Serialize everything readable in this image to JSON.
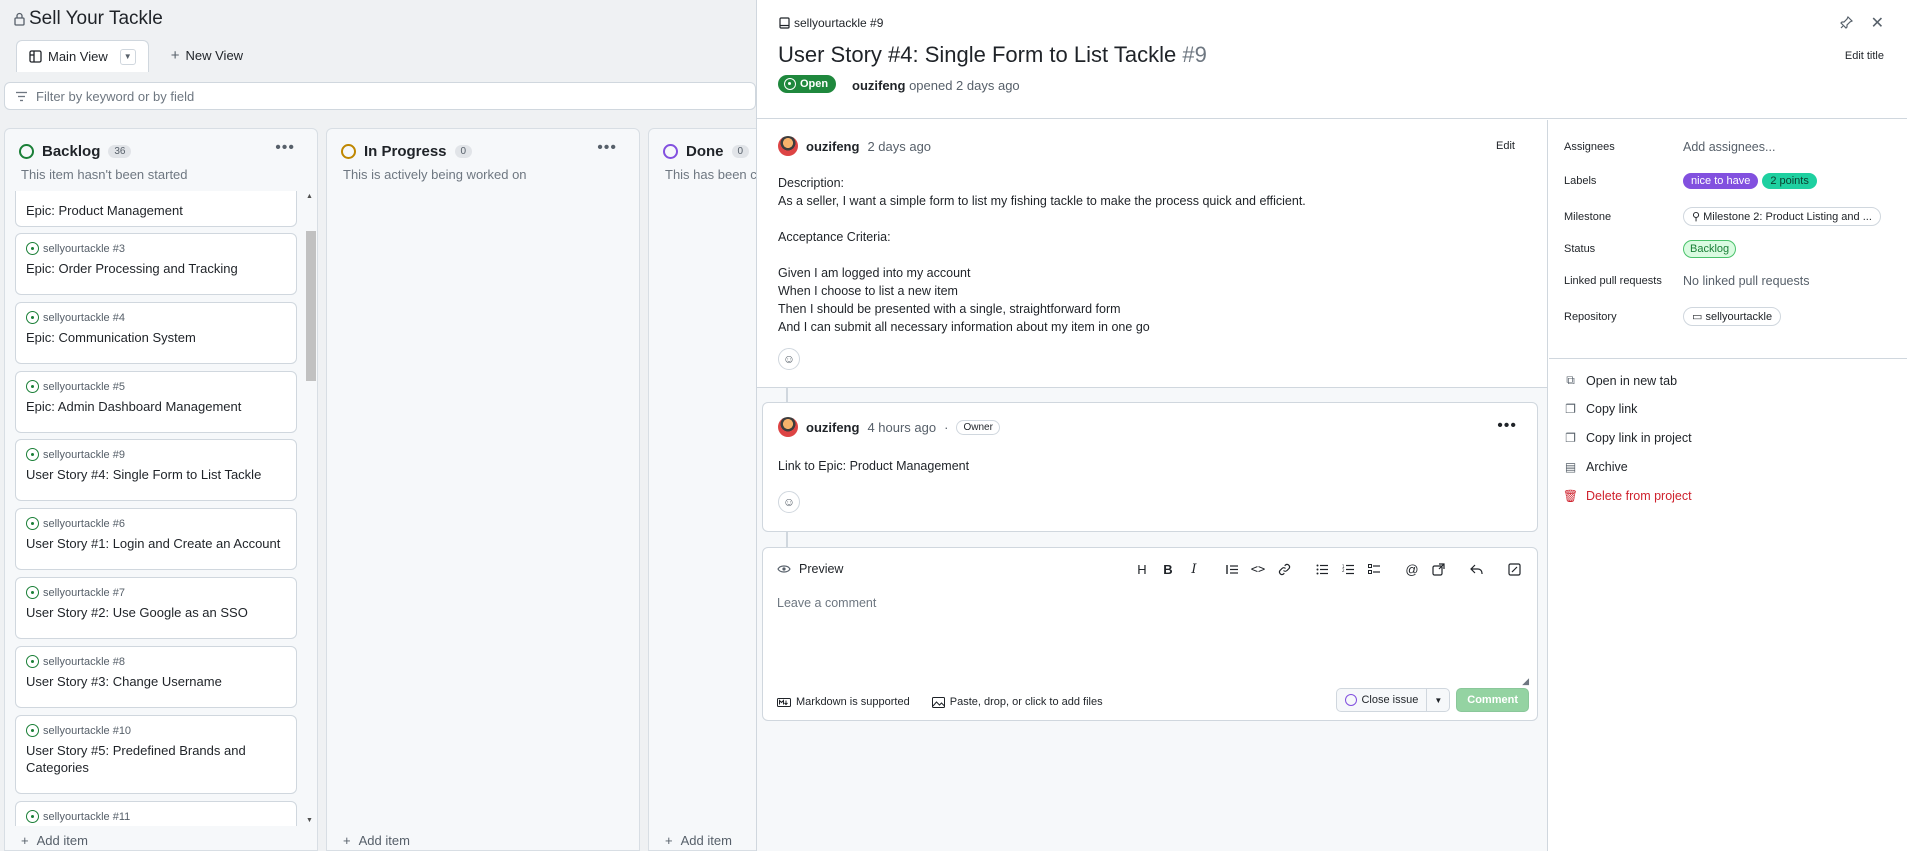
{
  "project": {
    "title": "Sell Your Tackle",
    "tabs": [
      {
        "label": "Main View"
      },
      {
        "label": "New View"
      }
    ],
    "filter_placeholder": "Filter by keyword or by field"
  },
  "columns": [
    {
      "name": "Backlog",
      "count": "36",
      "subtitle": "This item hasn't been started",
      "color": "#1a7f37",
      "add_label": "Add item"
    },
    {
      "name": "In Progress",
      "count": "0",
      "subtitle": "This is actively being worked on",
      "color": "#bf8700",
      "add_label": "Add item"
    },
    {
      "name": "Done",
      "count": "0",
      "subtitle": "This has been co",
      "color": "#8250df",
      "add_label": "Add item"
    }
  ],
  "backlog_cards": [
    {
      "repo": "",
      "title": "Epic: Product Management"
    },
    {
      "repo": "sellyourtackle #3",
      "title": "Epic: Order Processing and Tracking"
    },
    {
      "repo": "sellyourtackle #4",
      "title": "Epic: Communication System"
    },
    {
      "repo": "sellyourtackle #5",
      "title": "Epic: Admin Dashboard Management"
    },
    {
      "repo": "sellyourtackle #9",
      "title": "User Story #4: Single Form to List Tackle"
    },
    {
      "repo": "sellyourtackle #6",
      "title": "User Story #1: Login and Create an Account"
    },
    {
      "repo": "sellyourtackle #7",
      "title": "User Story #2: Use Google as an SSO"
    },
    {
      "repo": "sellyourtackle #8",
      "title": "User Story #3: Change Username"
    },
    {
      "repo": "sellyourtackle #10",
      "title": "User Story #5: Predefined Brands and Categories"
    },
    {
      "repo": "sellyourtackle #11",
      "title": ""
    }
  ],
  "issue": {
    "repo_ref": "sellyourtackle #9",
    "title": "User Story #4: Single Form to List Tackle",
    "number": "#9",
    "state": "Open",
    "author": "ouzifeng",
    "opened_text": "opened 2 days ago",
    "edit_title": "Edit title",
    "description": {
      "author": "ouzifeng",
      "time": "2 days ago",
      "edit": "Edit",
      "body": "Description:\nAs a seller, I want a simple form to list my fishing tackle to make the process quick and efficient.\n\nAcceptance Criteria:\n\nGiven I am logged into my account\nWhen I choose to list a new item\nThen I should be presented with a single, straightforward form\nAnd I can submit all necessary information about my item in one go"
    },
    "comment": {
      "author": "ouzifeng",
      "time": "4 hours ago",
      "separator": "·",
      "badge": "Owner",
      "body": "Link to Epic: Product Management"
    },
    "editor": {
      "tab": "Preview",
      "placeholder": "Leave a comment",
      "markdown_note": "Markdown is supported",
      "attach_note": "Paste, drop, or click to add files",
      "close_label": "Close issue",
      "comment_label": "Comment"
    }
  },
  "sidebar": {
    "fields": [
      {
        "label": "Assignees",
        "value": "Add assignees..."
      },
      {
        "label": "Labels"
      },
      {
        "label": "Milestone",
        "value": "Milestone 2: Product Listing and ..."
      },
      {
        "label": "Status",
        "value": "Backlog"
      },
      {
        "label": "Linked pull requests",
        "value": "No linked pull requests"
      },
      {
        "label": "Repository",
        "value": "sellyourtackle"
      }
    ],
    "labels": [
      {
        "text": "nice to have",
        "bg": "#8250df",
        "fg": "#ffffff"
      },
      {
        "text": "2 points",
        "bg": "#1ed0a0",
        "fg": "#0b3d2e"
      }
    ],
    "actions": [
      {
        "label": "Open in new tab",
        "icon": "external-link-icon"
      },
      {
        "label": "Copy link",
        "icon": "copy-icon"
      },
      {
        "label": "Copy link in project",
        "icon": "copy-icon"
      },
      {
        "label": "Archive",
        "icon": "archive-icon"
      },
      {
        "label": "Delete from project",
        "icon": "trash-icon"
      }
    ]
  }
}
